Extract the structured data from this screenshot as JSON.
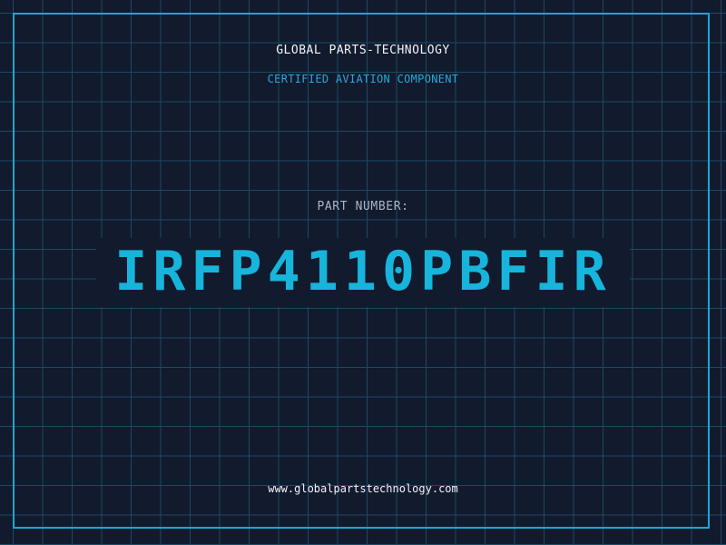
{
  "header": {
    "company": "GLOBAL PARTS-TECHNOLOGY",
    "tagline": "CERTIFIED AVIATION COMPONENT"
  },
  "part": {
    "label": "PART NUMBER:",
    "number": "IRFP4110PBFIR"
  },
  "footer": {
    "website": "www.globalpartstechnology.com"
  },
  "colors": {
    "background": "#121a2e",
    "grid": "#1b4a62",
    "accent": "#19a7d4",
    "text": "#f2f4f7"
  }
}
